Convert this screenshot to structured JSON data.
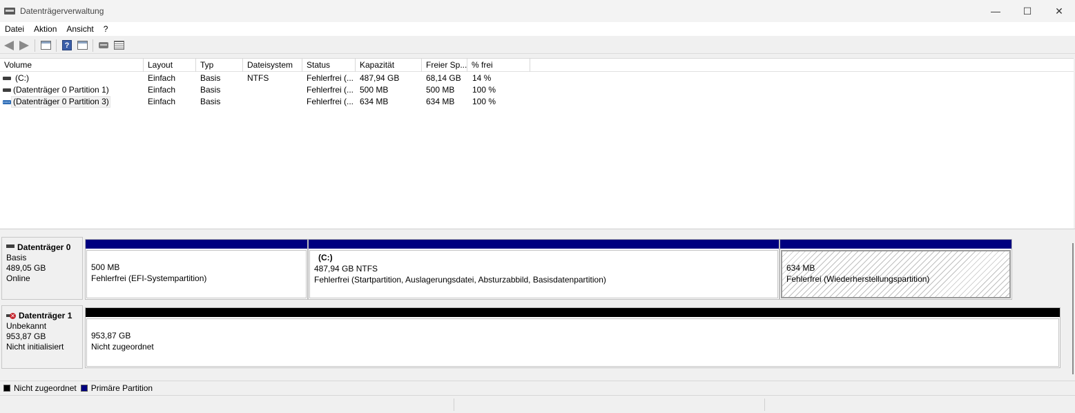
{
  "window": {
    "title": "Datenträgerverwaltung",
    "minimize": "—",
    "maximize": "☐",
    "close": "✕"
  },
  "menu": [
    "Datei",
    "Aktion",
    "Ansicht",
    "?"
  ],
  "list": {
    "columns": [
      "Volume",
      "Layout",
      "Typ",
      "Dateisystem",
      "Status",
      "Kapazität",
      "Freier Sp...",
      "% frei"
    ],
    "rows": [
      {
        "volume": "(C:)",
        "layout": "Einfach",
        "typ": "Basis",
        "fs": "NTFS",
        "status": "Fehlerfrei (...",
        "cap": "487,94 GB",
        "free": "68,14 GB",
        "pct": "14 %"
      },
      {
        "volume": "(Datenträger 0 Partition 1)",
        "layout": "Einfach",
        "typ": "Basis",
        "fs": "",
        "status": "Fehlerfrei (...",
        "cap": "500 MB",
        "free": "500 MB",
        "pct": "100 %"
      },
      {
        "volume": "(Datenträger 0 Partition 3)",
        "layout": "Einfach",
        "typ": "Basis",
        "fs": "",
        "status": "Fehlerfrei (...",
        "cap": "634 MB",
        "free": "634 MB",
        "pct": "100 %"
      }
    ]
  },
  "disks": [
    {
      "name": "Datenträger 0",
      "type": "Basis",
      "size": "489,05 GB",
      "state": "Online",
      "partitions": [
        {
          "size": "500 MB",
          "status": "Fehlerfrei (EFI-Systempartition)"
        },
        {
          "label": "(C:)",
          "size": "487,94 GB NTFS",
          "status": "Fehlerfrei (Startpartition, Auslagerungsdatei, Absturzabbild, Basisdatenpartition)"
        },
        {
          "size": "634 MB",
          "status": "Fehlerfrei (Wiederherstellungspartition)"
        }
      ]
    },
    {
      "name": "Datenträger 1",
      "type": "Unbekannt",
      "size": "953,87 GB",
      "state": "Nicht initialisiert",
      "partitions": [
        {
          "size": "953,87 GB",
          "status": "Nicht zugeordnet"
        }
      ]
    }
  ],
  "legend": [
    {
      "label": "Nicht zugeordnet",
      "color": "#000000"
    },
    {
      "label": "Primäre Partition",
      "color": "#000080"
    }
  ],
  "colors": {
    "primary_partition": "#000080",
    "unallocated": "#000000"
  },
  "icons": [
    "back-icon",
    "forward-icon",
    "console-tree-icon",
    "help-icon",
    "properties-icon",
    "connect-disk-icon",
    "list-view-icon"
  ]
}
